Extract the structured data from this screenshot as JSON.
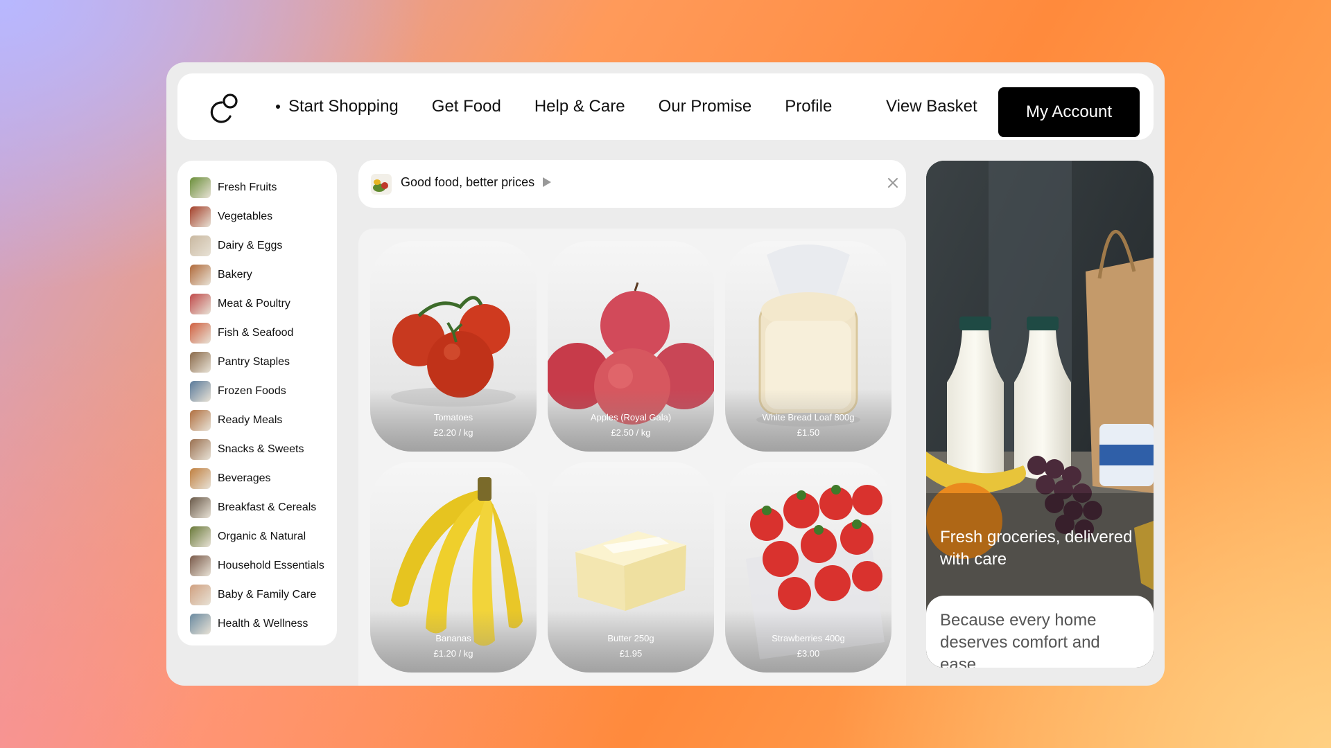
{
  "nav": {
    "links": [
      "Start Shopping",
      "Get Food",
      "Help & Care",
      "Our Promise",
      "Profile"
    ],
    "basket": "View Basket",
    "account": "My Account"
  },
  "sidebar": {
    "items": [
      {
        "label": "Fresh Fruits",
        "color": "#6b8f3a"
      },
      {
        "label": "Vegetables",
        "color": "#a4402a"
      },
      {
        "label": "Dairy & Eggs",
        "color": "#c9b8a0"
      },
      {
        "label": "Bakery",
        "color": "#b06a3a"
      },
      {
        "label": "Meat & Poultry",
        "color": "#c04a4a"
      },
      {
        "label": "Fish & Seafood",
        "color": "#d06040"
      },
      {
        "label": "Pantry Staples",
        "color": "#8a6a4a"
      },
      {
        "label": "Frozen Foods",
        "color": "#5a7a9a"
      },
      {
        "label": "Ready Meals",
        "color": "#b07040"
      },
      {
        "label": "Snacks & Sweets",
        "color": "#9a7050"
      },
      {
        "label": "Beverages",
        "color": "#c08040"
      },
      {
        "label": "Breakfast & Cereals",
        "color": "#6a5a4a"
      },
      {
        "label": "Organic & Natural",
        "color": "#6a7a3a"
      },
      {
        "label": "Household Essentials",
        "color": "#7a5a4a"
      },
      {
        "label": "Baby & Family Care",
        "color": "#d0a080"
      },
      {
        "label": "Health & Wellness",
        "color": "#6a8aa0"
      }
    ]
  },
  "banner": {
    "text": "Good food, better prices"
  },
  "products": [
    {
      "name": "Tomatoes",
      "price": "£2.20 / kg"
    },
    {
      "name": "Apples (Royal Gala)",
      "price": "£2.50 / kg"
    },
    {
      "name": "White Bread Loaf 800g",
      "price": "£1.50"
    },
    {
      "name": "Bananas",
      "price": "£1.20 / kg"
    },
    {
      "name": "Butter 250g",
      "price": "£1.95"
    },
    {
      "name": "Strawberries 400g",
      "price": "£3.00"
    }
  ],
  "hero": {
    "caption": "Fresh groceries, delivered with care",
    "subtext": "Because every home deserves comfort and ease"
  }
}
